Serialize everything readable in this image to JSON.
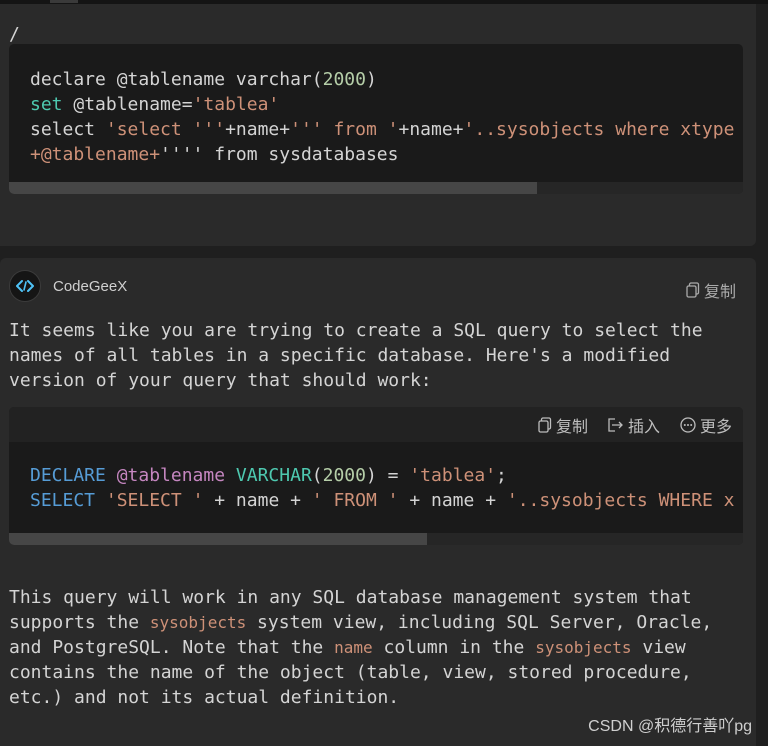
{
  "prompt_card": {
    "slash": "/",
    "code_lines": [
      [
        {
          "t": "declare @tablename varchar(",
          "c": "plain"
        },
        {
          "t": "2000",
          "c": "num"
        },
        {
          "t": ")",
          "c": "plain"
        }
      ],
      [
        {
          "t": "set",
          "c": "kw-green"
        },
        {
          "t": " @tablename=",
          "c": "plain"
        },
        {
          "t": "'tablea'",
          "c": "str"
        }
      ],
      [
        {
          "t": "select ",
          "c": "plain"
        },
        {
          "t": "'select '''",
          "c": "str"
        },
        {
          "t": "+name+",
          "c": "plain"
        },
        {
          "t": "''' from '",
          "c": "str"
        },
        {
          "t": "+name+",
          "c": "plain"
        },
        {
          "t": "'..sysobjects where xtype",
          "c": "str"
        }
      ],
      [
        {
          "t": "+@tablename+",
          "c": "str"
        },
        {
          "t": "''''",
          "c": "plain"
        },
        {
          "t": " from sysdatabases",
          "c": "plain"
        }
      ]
    ],
    "scroll_thumb_fraction": 0.72
  },
  "response_card": {
    "author": "CodeGeeX",
    "copy_label": "复制",
    "intro_lines": [
      "It seems like you are trying to create a SQL query to select the",
      "names of all tables in a specific database. Here's a modified",
      "version of your query that should work:"
    ],
    "code_toolbar": {
      "copy": "复制",
      "insert": "插入",
      "more": "更多"
    },
    "code_lines": [
      [
        {
          "t": "DECLARE",
          "c": "kw-blue"
        },
        {
          "t": " ",
          "c": "plain"
        },
        {
          "t": "@tablename",
          "c": "var"
        },
        {
          "t": " ",
          "c": "plain"
        },
        {
          "t": "VARCHAR",
          "c": "kw-green"
        },
        {
          "t": "(",
          "c": "plain"
        },
        {
          "t": "2000",
          "c": "num"
        },
        {
          "t": ") = ",
          "c": "plain"
        },
        {
          "t": "'tablea'",
          "c": "str"
        },
        {
          "t": ";",
          "c": "plain"
        }
      ],
      [
        {
          "t": "SELECT",
          "c": "kw-blue"
        },
        {
          "t": " ",
          "c": "plain"
        },
        {
          "t": "'SELECT '",
          "c": "str"
        },
        {
          "t": " + name + ",
          "c": "plain"
        },
        {
          "t": "' FROM '",
          "c": "str"
        },
        {
          "t": " + name + ",
          "c": "plain"
        },
        {
          "t": "'..sysobjects WHERE x",
          "c": "str"
        }
      ]
    ],
    "scroll_thumb_fraction": 0.57,
    "outro_lines": [
      [
        {
          "t": "This query will work in any SQL database management system that",
          "c": "plain"
        }
      ],
      [
        {
          "t": "supports the ",
          "c": "plain"
        },
        {
          "t": "sysobjects",
          "c": "inline"
        },
        {
          "t": " system view, including SQL Server, Oracle,",
          "c": "plain"
        }
      ],
      [
        {
          "t": "and PostgreSQL. Note that the ",
          "c": "plain"
        },
        {
          "t": "name",
          "c": "inline"
        },
        {
          "t": " column in the ",
          "c": "plain"
        },
        {
          "t": "sysobjects",
          "c": "inline"
        },
        {
          "t": " view",
          "c": "plain"
        }
      ],
      [
        {
          "t": "contains the name of the object (table, view, stored procedure,",
          "c": "plain"
        }
      ],
      [
        {
          "t": "etc.) and not its actual definition.",
          "c": "plain"
        }
      ]
    ]
  },
  "watermark": "CSDN @积德行善吖pg",
  "colors": {
    "background": "#1f1f1f",
    "card": "#2a2a2a",
    "code_bg": "#1a1a1a",
    "string": "#ce9178",
    "keyword_blue": "#569cd6",
    "keyword_teal": "#4ec9b0",
    "number": "#b5cea8",
    "variable": "#c586c0"
  }
}
